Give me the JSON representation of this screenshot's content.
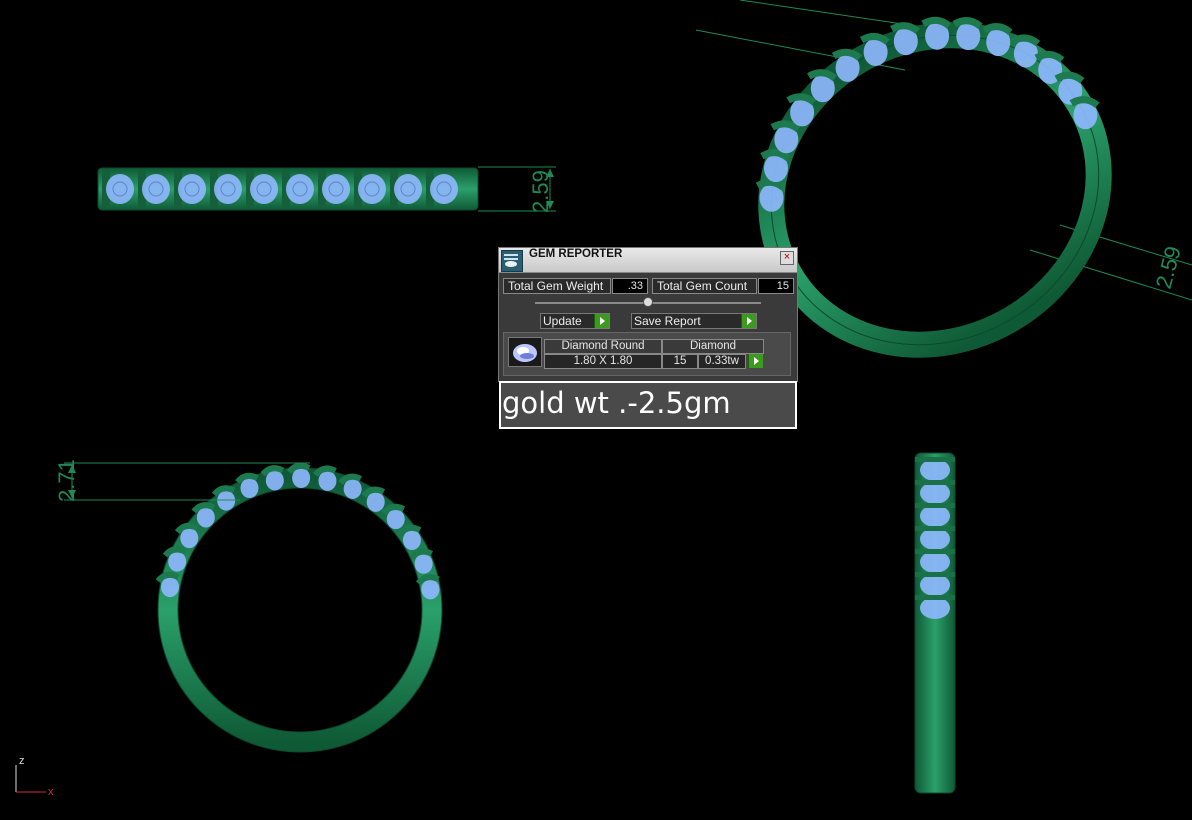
{
  "gem_reporter": {
    "title": "GEM REPORTER",
    "close_symbol": "×",
    "total_gem_weight_label": "Total Gem Weight",
    "total_gem_weight_value": ".33",
    "total_gem_count_label": "Total Gem Count",
    "total_gem_count_value": "15",
    "update_button": "Update",
    "save_report_button": "Save Report",
    "gem_row": {
      "shape_header": "Diamond Round",
      "size": "1.80 X 1.80",
      "type_header": "Diamond",
      "count": "15",
      "weight": "0.33tw"
    }
  },
  "note": "gold wt .-2.5gm",
  "dimensions": {
    "top_view": "2.59",
    "perspective_view": "2.59",
    "front_view": "2.71"
  },
  "axis": {
    "vertical": "z",
    "horizontal": "x"
  },
  "colors": {
    "background": "#000000",
    "metal": "#1d7a4e",
    "gem": "#8fb8ff",
    "dimension": "#1f8a55"
  }
}
